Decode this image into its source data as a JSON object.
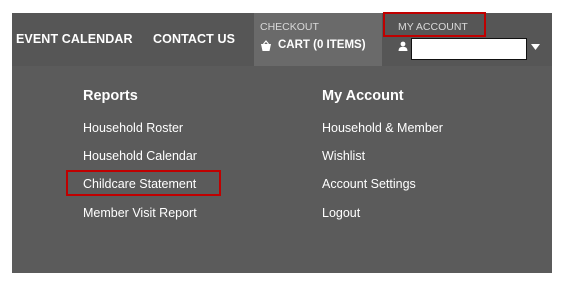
{
  "nav": {
    "event_calendar": "EVENT CALENDAR",
    "contact_us": "CONTACT US",
    "checkout_label": "CHECKOUT",
    "cart_label": "CART (0 ITEMS)",
    "my_account_label": "MY ACCOUNT",
    "username": ""
  },
  "dropdown": {
    "reports": {
      "heading": "Reports",
      "items": [
        "Household Roster",
        "Household Calendar",
        "Childcare Statement",
        "Member Visit Report"
      ]
    },
    "my_account": {
      "heading": "My Account",
      "items": [
        "Household & Member",
        "Wishlist",
        "Account Settings",
        "Logout"
      ]
    }
  },
  "annotations": {
    "highlight_color": "#c00000"
  },
  "icons": [
    "cart-icon",
    "user-icon",
    "caret-down-icon"
  ]
}
